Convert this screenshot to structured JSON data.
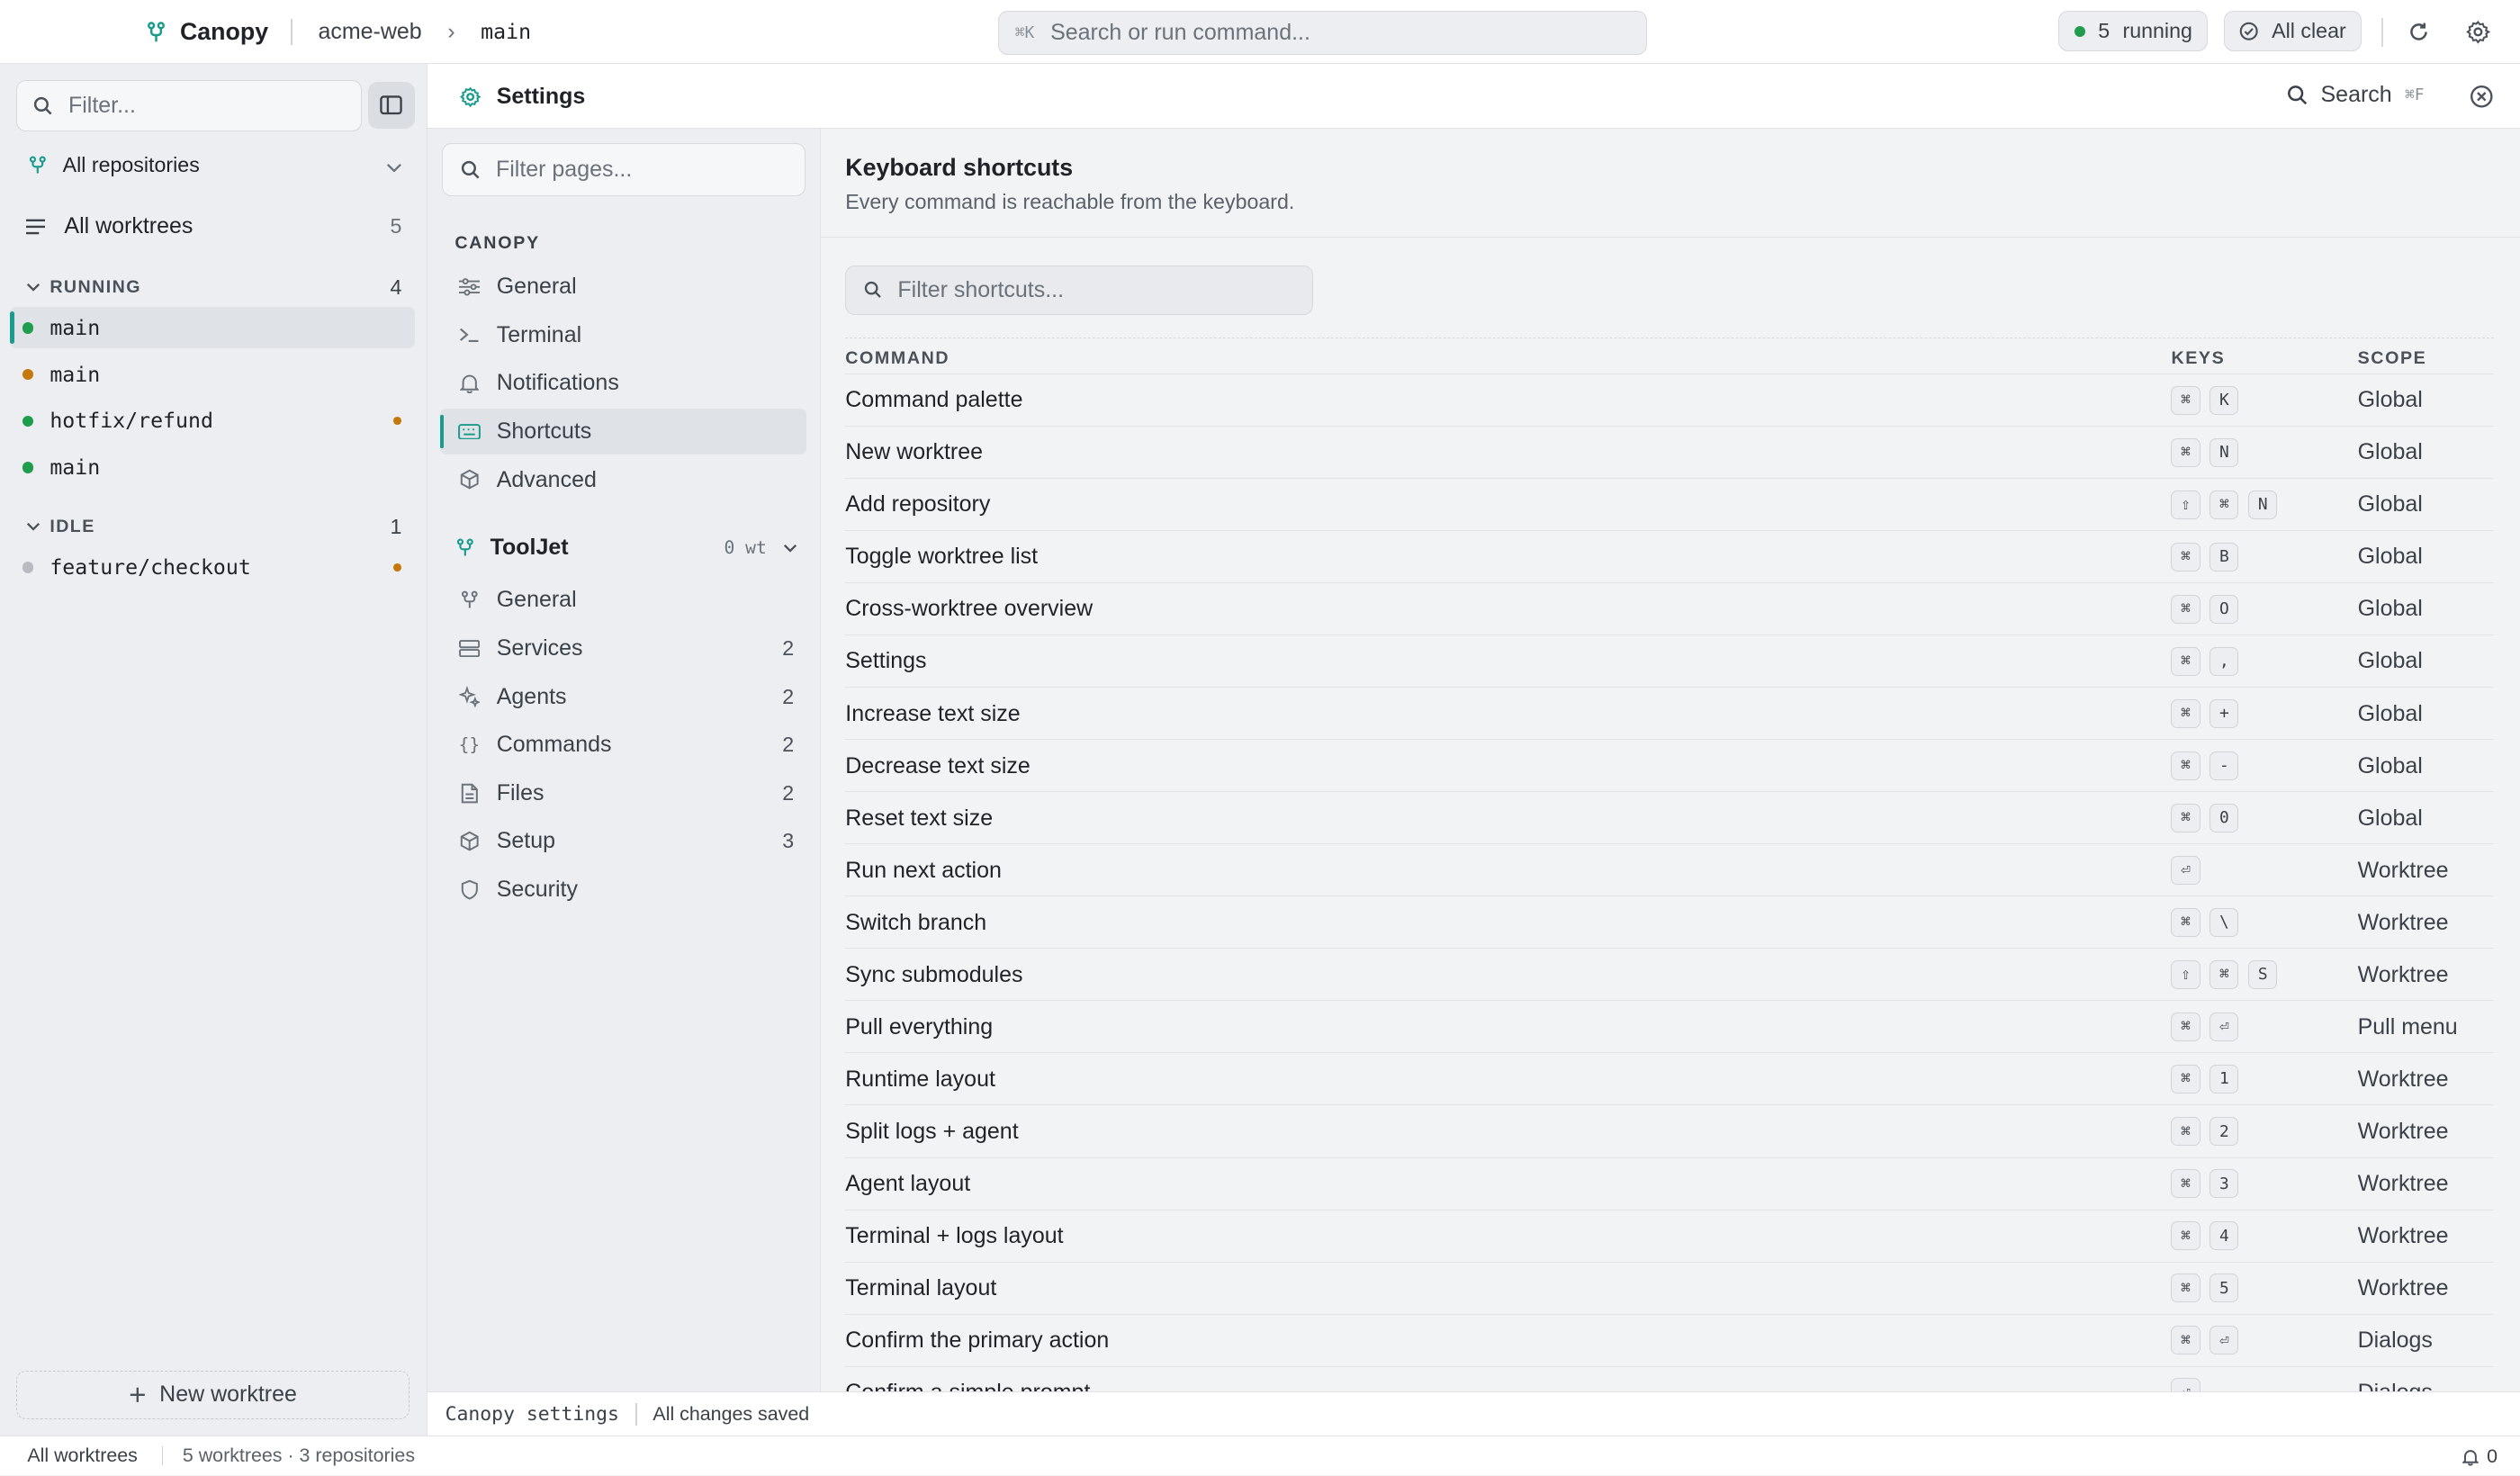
{
  "colors": {
    "accent": "#1a9c8c",
    "running": "#1f9d4c",
    "pending": "#c5780c",
    "idle": "#b8bcc2"
  },
  "topbar": {
    "app_name": "Canopy",
    "repo": "acme-web",
    "branch": "main",
    "search_hint": "⌘K",
    "search_placeholder": "Search or run command...",
    "running_count": "5",
    "running_label": "running",
    "all_clear_label": "All clear"
  },
  "sidebar": {
    "filter_placeholder": "Filter...",
    "repo_filter": "All repositories",
    "all_worktrees_label": "All worktrees",
    "all_worktrees_count": "5",
    "groups": [
      {
        "label": "RUNNING",
        "count": "4",
        "items": [
          {
            "name": "main",
            "status": "running",
            "active": true,
            "pending": false
          },
          {
            "name": "main",
            "status": "pending",
            "active": false,
            "pending": false
          },
          {
            "name": "hotfix/refund",
            "status": "running",
            "active": false,
            "pending": true
          },
          {
            "name": "main",
            "status": "running",
            "active": false,
            "pending": false
          }
        ]
      },
      {
        "label": "IDLE",
        "count": "1",
        "items": [
          {
            "name": "feature/checkout",
            "status": "idle",
            "active": false,
            "pending": true
          }
        ]
      }
    ],
    "new_worktree_label": "New worktree"
  },
  "settings": {
    "title": "Settings",
    "search_label": "Search",
    "search_hint": "⌘F",
    "nav_filter_placeholder": "Filter pages...",
    "section_label": "CANOPY",
    "global_pages": [
      {
        "label": "General",
        "icon": "sliders-icon"
      },
      {
        "label": "Terminal",
        "icon": "terminal-icon"
      },
      {
        "label": "Notifications",
        "icon": "bell-icon"
      },
      {
        "label": "Shortcuts",
        "icon": "keyboard-icon"
      },
      {
        "label": "Advanced",
        "icon": "cube-icon"
      }
    ],
    "project": {
      "name": "ToolJet",
      "meta": "0 wt"
    },
    "project_pages": [
      {
        "label": "General",
        "icon": "branch-icon",
        "count": ""
      },
      {
        "label": "Services",
        "icon": "server-icon",
        "count": "2"
      },
      {
        "label": "Agents",
        "icon": "sparkle-icon",
        "count": "2"
      },
      {
        "label": "Commands",
        "icon": "braces-icon",
        "count": "2"
      },
      {
        "label": "Files",
        "icon": "file-icon",
        "count": "2"
      },
      {
        "label": "Setup",
        "icon": "cube-icon",
        "count": "3"
      },
      {
        "label": "Security",
        "icon": "shield-icon",
        "count": ""
      }
    ],
    "active_page": "Shortcuts"
  },
  "shortcuts": {
    "heading": "Keyboard shortcuts",
    "subheading": "Every command is reachable from the keyboard.",
    "filter_placeholder": "Filter shortcuts...",
    "columns": {
      "command": "COMMAND",
      "keys": "KEYS",
      "scope": "SCOPE"
    },
    "rows": [
      {
        "command": "Command palette",
        "keys": [
          "⌘",
          "K"
        ],
        "scope": "Global"
      },
      {
        "command": "New worktree",
        "keys": [
          "⌘",
          "N"
        ],
        "scope": "Global"
      },
      {
        "command": "Add repository",
        "keys": [
          "⇧",
          "⌘",
          "N"
        ],
        "scope": "Global"
      },
      {
        "command": "Toggle worktree list",
        "keys": [
          "⌘",
          "B"
        ],
        "scope": "Global"
      },
      {
        "command": "Cross-worktree overview",
        "keys": [
          "⌘",
          "O"
        ],
        "scope": "Global"
      },
      {
        "command": "Settings",
        "keys": [
          "⌘",
          ","
        ],
        "scope": "Global"
      },
      {
        "command": "Increase text size",
        "keys": [
          "⌘",
          "+"
        ],
        "scope": "Global"
      },
      {
        "command": "Decrease text size",
        "keys": [
          "⌘",
          "-"
        ],
        "scope": "Global"
      },
      {
        "command": "Reset text size",
        "keys": [
          "⌘",
          "0"
        ],
        "scope": "Global"
      },
      {
        "command": "Run next action",
        "keys": [
          "⏎"
        ],
        "scope": "Worktree"
      },
      {
        "command": "Switch branch",
        "keys": [
          "⌘",
          "\\"
        ],
        "scope": "Worktree"
      },
      {
        "command": "Sync submodules",
        "keys": [
          "⇧",
          "⌘",
          "S"
        ],
        "scope": "Worktree"
      },
      {
        "command": "Pull everything",
        "keys": [
          "⌘",
          "⏎"
        ],
        "scope": "Pull menu"
      },
      {
        "command": "Runtime layout",
        "keys": [
          "⌘",
          "1"
        ],
        "scope": "Worktree"
      },
      {
        "command": "Split logs + agent",
        "keys": [
          "⌘",
          "2"
        ],
        "scope": "Worktree"
      },
      {
        "command": "Agent layout",
        "keys": [
          "⌘",
          "3"
        ],
        "scope": "Worktree"
      },
      {
        "command": "Terminal + logs layout",
        "keys": [
          "⌘",
          "4"
        ],
        "scope": "Worktree"
      },
      {
        "command": "Terminal layout",
        "keys": [
          "⌘",
          "5"
        ],
        "scope": "Worktree"
      },
      {
        "command": "Confirm the primary action",
        "keys": [
          "⌘",
          "⏎"
        ],
        "scope": "Dialogs"
      },
      {
        "command": "Confirm a simple prompt",
        "keys": [
          "⏎"
        ],
        "scope": "Dialogs"
      }
    ]
  },
  "settings_status": {
    "context": "Canopy settings",
    "save_state": "All changes saved"
  },
  "statusbar": {
    "view": "All worktrees",
    "summary": "5 worktrees · 3 repositories",
    "notifications": "0"
  }
}
